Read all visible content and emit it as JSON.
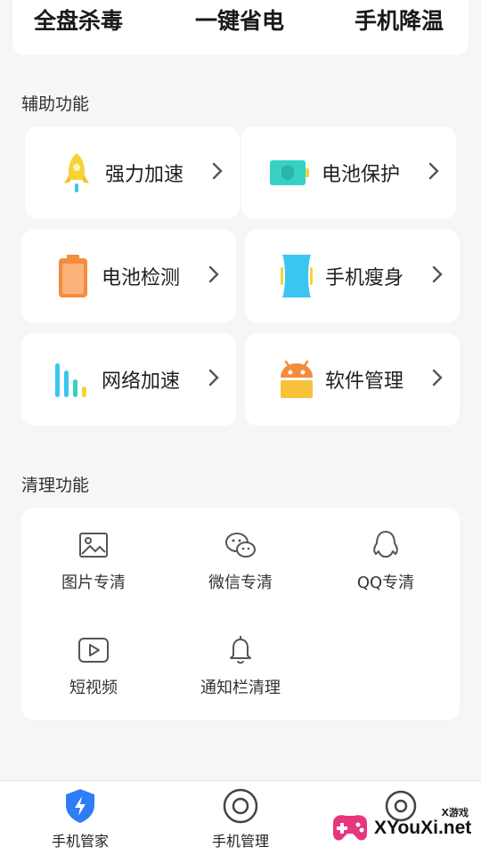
{
  "top": {
    "items": [
      "全盘杀毒",
      "一键省电",
      "手机降温"
    ]
  },
  "assist": {
    "title": "辅助功能",
    "items": [
      {
        "label": "强力加速",
        "icon": "rocket-icon"
      },
      {
        "label": "电池保护",
        "icon": "battery-shield-icon"
      },
      {
        "label": "电池检测",
        "icon": "battery-icon"
      },
      {
        "label": "手机瘦身",
        "icon": "phone-slim-icon"
      },
      {
        "label": "网络加速",
        "icon": "signal-bars-icon"
      },
      {
        "label": "软件管理",
        "icon": "android-icon"
      }
    ]
  },
  "clean": {
    "title": "清理功能",
    "items": [
      {
        "label": "图片专清",
        "icon": "image-icon"
      },
      {
        "label": "微信专清",
        "icon": "wechat-icon"
      },
      {
        "label": "QQ专清",
        "icon": "qq-icon"
      },
      {
        "label": "短视频",
        "icon": "video-icon"
      },
      {
        "label": "通知栏清理",
        "icon": "bell-icon"
      }
    ]
  },
  "tabs": [
    {
      "label": "手机管家",
      "icon": "shield-bolt-icon"
    },
    {
      "label": "手机管理",
      "icon": "circle-target-icon"
    },
    {
      "label": "",
      "icon": "gear-cloud-icon"
    }
  ],
  "watermark": {
    "small": "X游戏",
    "text": "XYouXi.net"
  },
  "colors": {
    "accent_blue": "#2f7cf6",
    "rocket_yellow": "#f7d33a",
    "battery_orange": "#f58b3c",
    "android_orange": "#f5a623",
    "teal": "#36d1c4",
    "cyan": "#3ac6f0"
  }
}
